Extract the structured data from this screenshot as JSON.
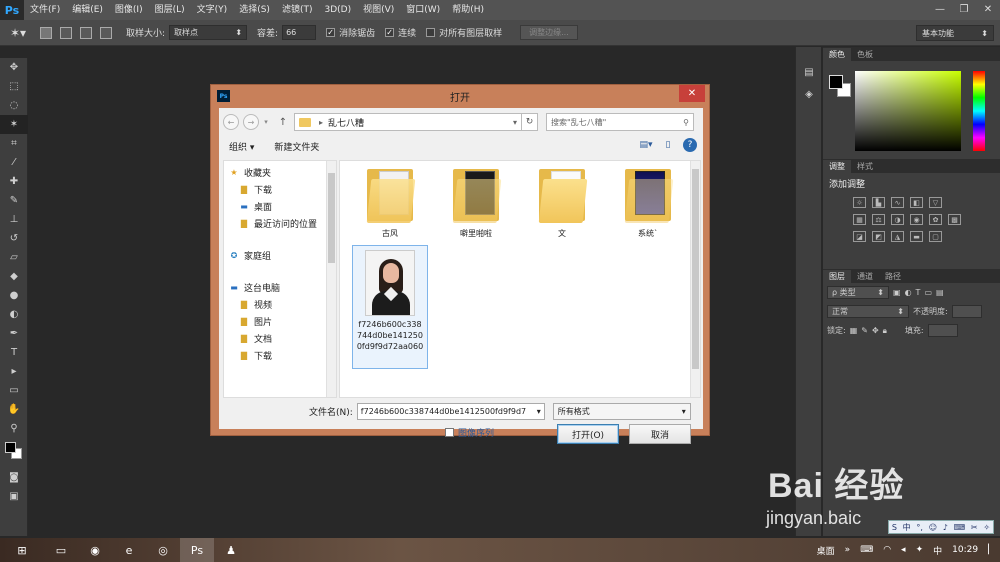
{
  "app": {
    "logo": "Ps",
    "menu": [
      "文件(F)",
      "编辑(E)",
      "图像(I)",
      "图层(L)",
      "文字(Y)",
      "选择(S)",
      "滤镜(T)",
      "3D(D)",
      "视图(V)",
      "窗口(W)",
      "帮助(H)"
    ]
  },
  "options": {
    "sample_size_label": "取样大小:",
    "sample_size_value": "取样点",
    "tolerance_label": "容差:",
    "tolerance_value": "66",
    "antialias_label": "消除锯齿",
    "contiguous_label": "连续",
    "all_layers_label": "对所有图层取样",
    "refine_edge_label": "调整边缘...",
    "workspace": "基本功能"
  },
  "panels": {
    "color_tabs": [
      "颜色",
      "色板"
    ],
    "adjust_tabs": [
      "调整",
      "样式"
    ],
    "adjust_title": "添加调整",
    "layers_tabs": [
      "图层",
      "通道",
      "路径"
    ],
    "kind_label": "ρ 类型",
    "blend_mode": "正常",
    "opacity_label": "不透明度:",
    "lock_label": "锁定:",
    "fill_label": "填充:"
  },
  "dialog": {
    "title": "打开",
    "breadcrumb": "乱七八糟",
    "search_placeholder": "搜索\"乱七八糟\"",
    "organize": "组织 ▾",
    "new_folder": "新建文件夹",
    "nav_items": [
      {
        "label": "收藏夹",
        "icon": "star-icon"
      },
      {
        "label": "下载",
        "icon": "download-folder-icon"
      },
      {
        "label": "桌面",
        "icon": "desktop-icon"
      },
      {
        "label": "最近访问的位置",
        "icon": "recent-places-icon"
      },
      {
        "label": "家庭组",
        "icon": "homegroup-icon"
      },
      {
        "label": "这台电脑",
        "icon": "computer-icon"
      },
      {
        "label": "视频",
        "icon": "videos-folder-icon"
      },
      {
        "label": "图片",
        "icon": "pictures-folder-icon"
      },
      {
        "label": "文档",
        "icon": "documents-folder-icon"
      },
      {
        "label": "下载",
        "icon": "download-folder-icon"
      }
    ],
    "files": [
      {
        "label": "古风"
      },
      {
        "label": "噼里啪啦"
      },
      {
        "label": "文"
      },
      {
        "label": "系统`"
      },
      {
        "label": "f7246b600c338744d0be1412500fd9f9d72aa060"
      }
    ],
    "filename_label": "文件名(N):",
    "filename_value": "f7246b600c338744d0be1412500fd9f9d7",
    "format_value": "所有格式",
    "sequence_label": "图像序列",
    "open_button": "打开(O)",
    "cancel_button": "取消"
  },
  "watermark": {
    "logo": "Bai 经验",
    "url": "jingyan.baic"
  },
  "taskbar": {
    "desktop_label": "桌面",
    "time": "10:29"
  },
  "colors": {
    "dialog_frame": "#c8805a",
    "close_button": "#c7403a",
    "ps_ui": "#535353"
  }
}
